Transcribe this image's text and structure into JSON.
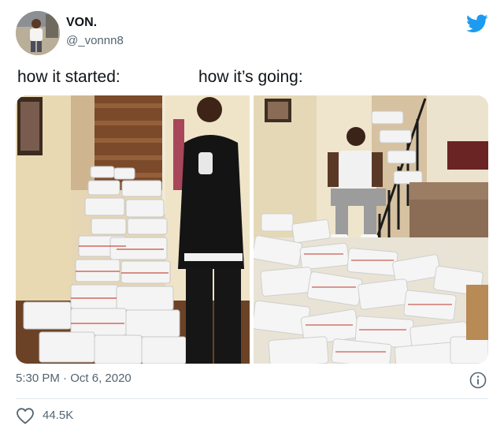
{
  "author": {
    "name": "VON.",
    "handle": "@_vonnn8",
    "avatar_icon": "profile-photo",
    "platform_icon": "twitter-bird-icon"
  },
  "captions": {
    "left": "how it started:",
    "right": "how it’s going:"
  },
  "timestamp": {
    "time": "5:30 PM",
    "separator": "·",
    "date": "Oct 6, 2020"
  },
  "engagement": {
    "likes": "44.5K"
  },
  "colors": {
    "twitter_blue": "#1d9bf0",
    "secondary_text": "#536471",
    "divider": "#e1e8ed"
  }
}
